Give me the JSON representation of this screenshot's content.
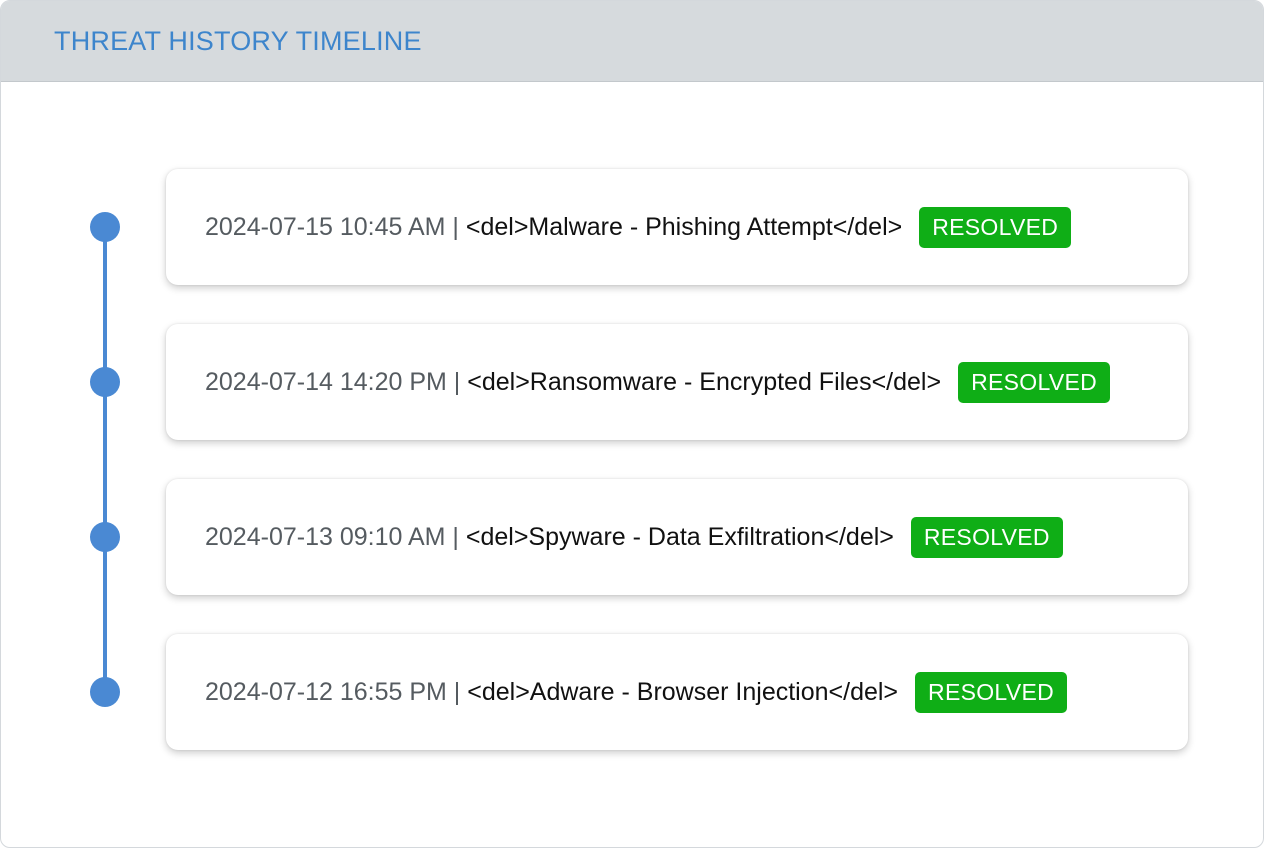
{
  "header": {
    "title": "THREAT HISTORY TIMELINE"
  },
  "events": [
    {
      "time": "2024-07-15 10:45 AM",
      "separator": " | ",
      "description": "<del>Malware - Phishing Attempt</del>",
      "status": "RESOLVED"
    },
    {
      "time": "2024-07-14 14:20 PM",
      "separator": " | ",
      "description": "<del>Ransomware - Encrypted Files</del>",
      "status": "RESOLVED"
    },
    {
      "time": "2024-07-13 09:10 AM",
      "separator": " | ",
      "description": "<del>Spyware - Data Exfiltration</del>",
      "status": "RESOLVED"
    },
    {
      "time": "2024-07-12 16:55 PM",
      "separator": " | ",
      "description": "<del>Adware - Browser Injection</del>",
      "status": "RESOLVED"
    }
  ],
  "colors": {
    "accent": "#4a89d3",
    "header_text": "#3d85cc",
    "header_bg": "#d6dadd",
    "status_resolved": "#0fae16"
  }
}
